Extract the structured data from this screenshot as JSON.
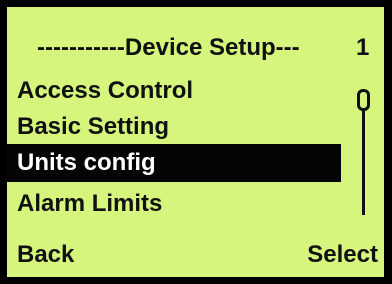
{
  "screen": {
    "title": "-----------Device Setup---",
    "page_number": "1",
    "background_color": "#d6f57c",
    "text_color": "#111111",
    "highlight_color": "#050505"
  },
  "menu": {
    "items": [
      {
        "label": "Access Control",
        "selected": false
      },
      {
        "label": "Basic Setting",
        "selected": false
      },
      {
        "label": "Units config",
        "selected": true
      },
      {
        "label": "Alarm Limits",
        "selected": false
      }
    ]
  },
  "scrollbar": {
    "position": 0
  },
  "softkeys": {
    "left_label": "Back",
    "right_label": "Select"
  }
}
